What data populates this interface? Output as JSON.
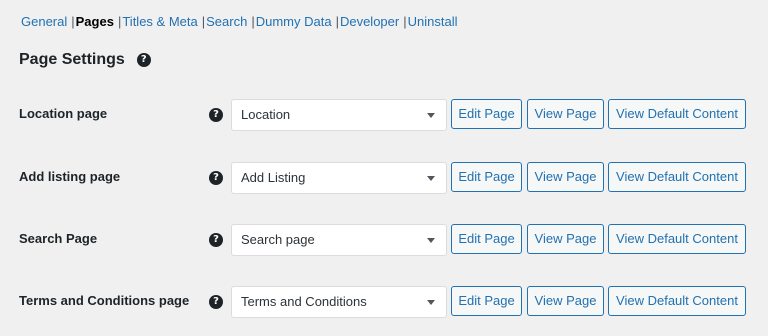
{
  "subnav": {
    "items": [
      "General",
      "Pages",
      "Titles & Meta",
      "Search",
      "Dummy Data",
      "Developer",
      "Uninstall"
    ],
    "separator": "|",
    "current": "Pages"
  },
  "page_title": "Page Settings",
  "help_glyph": "?",
  "rows": [
    {
      "label": "Location page",
      "selected": "Location"
    },
    {
      "label": "Add listing page",
      "selected": "Add Listing"
    },
    {
      "label": "Search Page",
      "selected": "Search page"
    },
    {
      "label": "Terms and Conditions page",
      "selected": "Terms and Conditions"
    }
  ],
  "buttons": {
    "edit": "Edit Page",
    "view": "View Page",
    "default": "View Default Content"
  },
  "icons": {
    "help": "question-circle-icon",
    "dropdown": "chevron-down-icon"
  },
  "colors": {
    "link": "#2271b1",
    "background": "#f0f0f1",
    "text": "#1d2327"
  }
}
